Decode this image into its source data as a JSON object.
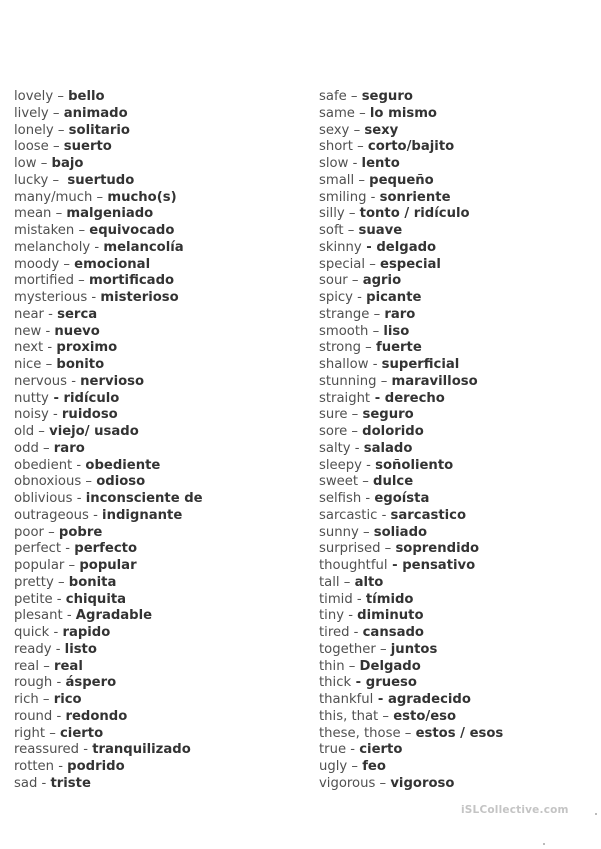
{
  "document": {
    "type": "vocabulary list (English – Spanish adjectives)",
    "left_column": [
      {
        "en": "lovely",
        "sep": " – ",
        "es": "bello"
      },
      {
        "en": "lively",
        "sep": " – ",
        "es": "animado"
      },
      {
        "en": "lonely",
        "sep": " – ",
        "es": "solitario"
      },
      {
        "en": "loose",
        "sep": " – ",
        "es": "suerto"
      },
      {
        "en": "low",
        "sep": " – ",
        "es": "bajo"
      },
      {
        "en": "lucky",
        "sep": " –  ",
        "es": "suertudo"
      },
      {
        "en": "many/much",
        "sep": " – ",
        "es": "mucho(s)"
      },
      {
        "en": "mean",
        "sep": " – ",
        "es": "malgeniado"
      },
      {
        "en": "mistaken",
        "sep": " – ",
        "es": "equivocado"
      },
      {
        "en": "melancholy",
        "sep": " - ",
        "es": "melancolía"
      },
      {
        "en": "moody",
        "sep": " – ",
        "es": "emocional"
      },
      {
        "en": "mortified",
        "sep": " – ",
        "es": "mortificado"
      },
      {
        "en": "mysterious",
        "sep": " - ",
        "es": "misterioso"
      },
      {
        "en": "near",
        "sep": " - ",
        "es": "serca"
      },
      {
        "en": "new",
        "sep": " - ",
        "es": "nuevo"
      },
      {
        "en": "next",
        "sep": " - ",
        "es": "proximo"
      },
      {
        "en": "nice",
        "sep": " – ",
        "es": "bonito"
      },
      {
        "en": "nervous",
        "sep": " - ",
        "es": "nervioso"
      },
      {
        "en": "nutty",
        "sep": " - ",
        "sep_bold": true,
        "es": "ridículo"
      },
      {
        "en": "noisy",
        "sep": " - ",
        "es": "ruidoso"
      },
      {
        "en": "old",
        "sep": " – ",
        "es": "viejo/ usado"
      },
      {
        "en": "odd",
        "sep": " – ",
        "es": "raro"
      },
      {
        "en": "obedient",
        "sep": " - ",
        "es": "obediente"
      },
      {
        "en": "obnoxious",
        "sep": " – ",
        "es": "odioso"
      },
      {
        "en": "oblivious",
        "sep": " - ",
        "es": "inconsciente de"
      },
      {
        "en": "outrageous",
        "sep": " - ",
        "es": "indignante"
      },
      {
        "en": "poor",
        "sep": " – ",
        "es": "pobre"
      },
      {
        "en": "perfect",
        "sep": " - ",
        "es": "perfecto"
      },
      {
        "en": "popular",
        "sep": " – ",
        "es": "popular"
      },
      {
        "en": "pretty",
        "sep": " – ",
        "es": "bonita"
      },
      {
        "en": "petite",
        "sep": " - ",
        "es": "chiquita"
      },
      {
        "en": "plesant",
        "sep": " - ",
        "es": "Agradable"
      },
      {
        "en": "quick",
        "sep": " - ",
        "es": "rapido"
      },
      {
        "en": "ready",
        "sep": " - ",
        "es": "listo"
      },
      {
        "en": "real",
        "sep": " – ",
        "es": "real"
      },
      {
        "en": "rough",
        "sep": " - ",
        "es": "áspero"
      },
      {
        "en": "rich",
        "sep": " – ",
        "es": "rico"
      },
      {
        "en": "round",
        "sep": " - ",
        "es": "redondo"
      },
      {
        "en": "right",
        "sep": " – ",
        "es": "cierto"
      },
      {
        "en": "reassured",
        "sep": " - ",
        "es": "tranquilizado"
      },
      {
        "en": "rotten",
        "sep": " - ",
        "es": "podrido"
      },
      {
        "en": "sad",
        "sep": " - ",
        "es": "triste"
      }
    ],
    "right_column": [
      {
        "en": "safe",
        "sep": " – ",
        "es": "seguro"
      },
      {
        "en": "same",
        "sep": " – ",
        "es": "lo mismo"
      },
      {
        "en": "sexy",
        "sep": " – ",
        "es": "sexy"
      },
      {
        "en": "short",
        "sep": " – ",
        "es": "corto/bajito"
      },
      {
        "en": "slow",
        "sep": " - ",
        "es": "lento"
      },
      {
        "en": "small",
        "sep": " – ",
        "es": "pequeño"
      },
      {
        "en": "smiling",
        "sep": " - ",
        "es": "sonriente"
      },
      {
        "en": "silly",
        "sep": " – ",
        "es": "tonto / ridículo"
      },
      {
        "en": "soft",
        "sep": " – ",
        "es": "suave"
      },
      {
        "en": "skinny",
        "sep": " - ",
        "sep_bold": true,
        "es": "delgado"
      },
      {
        "en": "special",
        "sep": " – ",
        "es": "especial"
      },
      {
        "en": "sour",
        "sep": " – ",
        "es": "agrio"
      },
      {
        "en": "spicy",
        "sep": " - ",
        "es": "picante"
      },
      {
        "en": "strange",
        "sep": " – ",
        "es": "raro"
      },
      {
        "en": "smooth",
        "sep": " – ",
        "es": "liso"
      },
      {
        "en": "strong",
        "sep": " – ",
        "es": "fuerte"
      },
      {
        "en": "shallow",
        "sep": " - ",
        "es": "superficial"
      },
      {
        "en": "stunning",
        "sep": " – ",
        "es": "maravilloso"
      },
      {
        "en": "straight",
        "sep": " - ",
        "sep_bold": true,
        "es": "derecho"
      },
      {
        "en": "sure",
        "sep": " – ",
        "es": "seguro"
      },
      {
        "en": "sore",
        "sep": " – ",
        "es": "dolorido"
      },
      {
        "en": "salty",
        "sep": " - ",
        "es": "salado"
      },
      {
        "en": "sleepy",
        "sep": " - ",
        "es": "soñoliento"
      },
      {
        "en": "sweet",
        "sep": " – ",
        "es": "dulce"
      },
      {
        "en": "selfish",
        "sep": " - ",
        "es": "egoísta"
      },
      {
        "en": "sarcastic",
        "sep": " - ",
        "es": "sarcastico"
      },
      {
        "en": "sunny",
        "sep": " – ",
        "es": "soliado"
      },
      {
        "en": "surprised",
        "sep": " – ",
        "es": "soprendido"
      },
      {
        "en": "thoughtful",
        "sep": " - ",
        "sep_bold": true,
        "es": "pensativo"
      },
      {
        "en": "tall",
        "sep": " – ",
        "es": "alto"
      },
      {
        "en": "timid",
        "sep": " - ",
        "es": "tímido"
      },
      {
        "en": "tiny",
        "sep": " - ",
        "es": "diminuto"
      },
      {
        "en": "tired",
        "sep": " - ",
        "es": "cansado"
      },
      {
        "en": "together",
        "sep": " – ",
        "es": "juntos"
      },
      {
        "en": "thin",
        "sep": " – ",
        "es": "Delgado"
      },
      {
        "en": "thick",
        "sep": " - ",
        "sep_bold": true,
        "es": "grueso"
      },
      {
        "en": "thankful",
        "sep": " - ",
        "sep_bold": true,
        "es": "agradecido"
      },
      {
        "en": "this, that",
        "sep": " – ",
        "es": "esto/eso"
      },
      {
        "en": "these, those",
        "sep": " – ",
        "es": "estos / esos"
      },
      {
        "en": "true",
        "sep": " - ",
        "es": "cierto"
      },
      {
        "en": "ugly",
        "sep": " – ",
        "es": "feo"
      },
      {
        "en": "vigorous",
        "sep": " – ",
        "es": "vigoroso"
      }
    ],
    "watermark": "iSLCollective.com"
  }
}
